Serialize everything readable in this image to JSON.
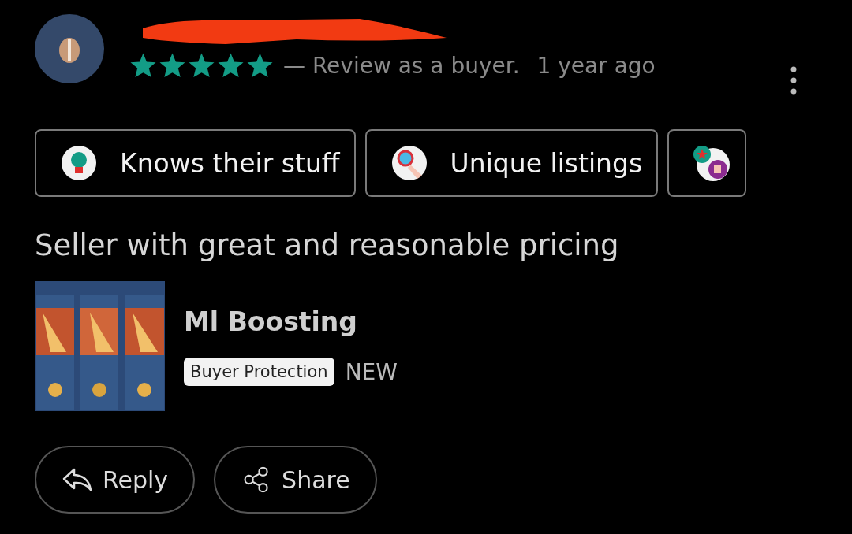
{
  "review": {
    "stars": 5,
    "role_text": "— Review as a buyer.",
    "time": "1 year ago"
  },
  "tags": [
    {
      "label": "Knows their stuff",
      "kind": "bulb"
    },
    {
      "label": "Unique listings",
      "kind": "magnifier"
    },
    {
      "kind": "thumb"
    }
  ],
  "comment": "Seller with great and reasonable pricing",
  "listing": {
    "kind": "picture",
    "title": "Ml Boosting",
    "badge": "Buyer Protection",
    "condition": "NEW"
  },
  "actions": [
    {
      "label": "Reply",
      "kind": "reply"
    },
    {
      "label": "Share",
      "kind": "share"
    }
  ]
}
